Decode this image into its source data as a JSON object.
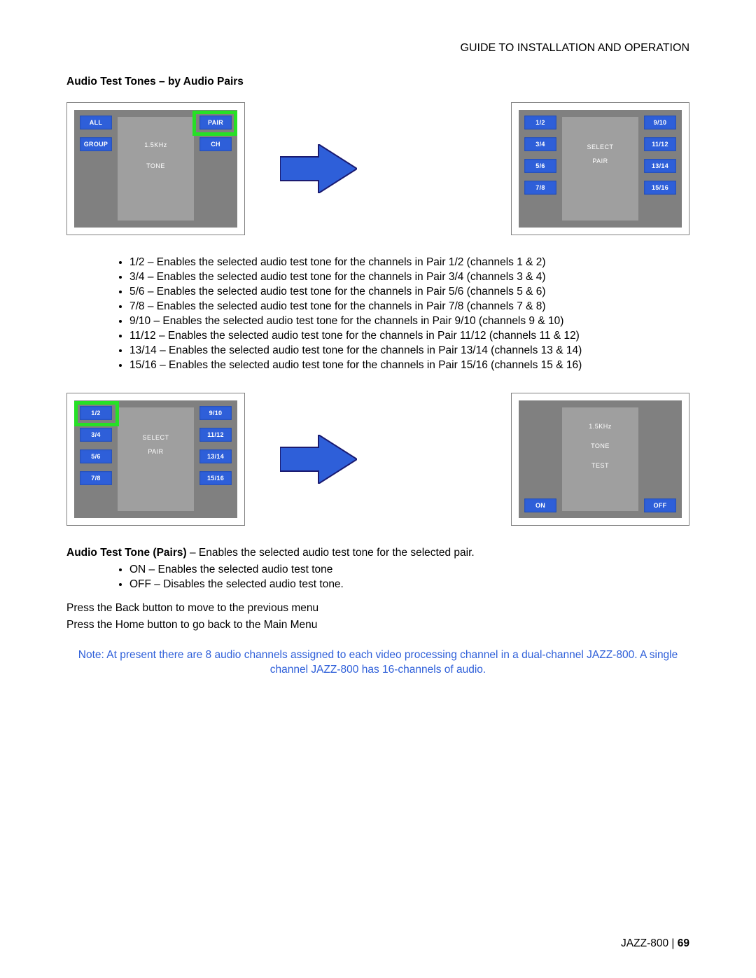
{
  "header": {
    "title": "GUIDE TO INSTALLATION AND OPERATION"
  },
  "section": {
    "title": "Audio Test Tones – by Audio Pairs"
  },
  "screen1": {
    "left": [
      "ALL",
      "GROUP"
    ],
    "right": [
      "PAIR",
      "CH"
    ],
    "center1": "1.5KHz",
    "center2": "TONE"
  },
  "screen2": {
    "left": [
      "1/2",
      "3/4",
      "5/6",
      "7/8"
    ],
    "right": [
      "9/10",
      "11/12",
      "13/14",
      "15/16"
    ],
    "center1": "SELECT",
    "center2": "PAIR"
  },
  "bulletsA": [
    "1/2 – Enables the selected audio test tone for the channels in Pair 1/2 (channels 1 & 2)",
    "3/4 – Enables the selected audio test tone for the channels in Pair 3/4 (channels 3 & 4)",
    "5/6 – Enables the selected audio test tone for the channels in Pair 5/6 (channels 5 & 6)",
    "7/8 – Enables the selected audio test tone for the channels in Pair 7/8 (channels 7 & 8)",
    "9/10 – Enables the selected audio test tone for the channels in Pair 9/10 (channels 9 & 10)",
    "11/12 – Enables the selected audio test tone for the channels in Pair 11/12 (channels 11 & 12)",
    "13/14 – Enables the selected audio test tone for the channels in Pair 13/14 (channels 13 & 14)",
    "15/16 – Enables the selected audio test tone for the channels in Pair 15/16 (channels 15 & 16)"
  ],
  "screen3": {
    "left": [
      "1/2",
      "3/4",
      "5/6",
      "7/8"
    ],
    "right": [
      "9/10",
      "11/12",
      "13/14",
      "15/16"
    ],
    "center1": "SELECT",
    "center2": "PAIR"
  },
  "screen4": {
    "left": [
      "ON"
    ],
    "right": [
      "OFF"
    ],
    "center1": "1.5KHz",
    "center2": "TONE",
    "center3": "TEST"
  },
  "descTitle": "Audio Test Tone (Pairs)",
  "descRest": " – Enables the selected audio test tone for the selected pair.",
  "bulletsB": [
    "ON – Enables the selected audio test tone",
    "OFF – Disables the selected audio test tone."
  ],
  "press1": "Press the Back button to move to the previous menu",
  "press2": "Press the Home button to go back to the Main Menu",
  "note": "Note: At present there are 8 audio channels assigned to each video processing channel in a dual-channel JAZZ-800. A single channel JAZZ-800 has 16-channels of audio.",
  "footer": {
    "product": "JAZZ-800",
    "sep": "  |  ",
    "page": "69"
  }
}
